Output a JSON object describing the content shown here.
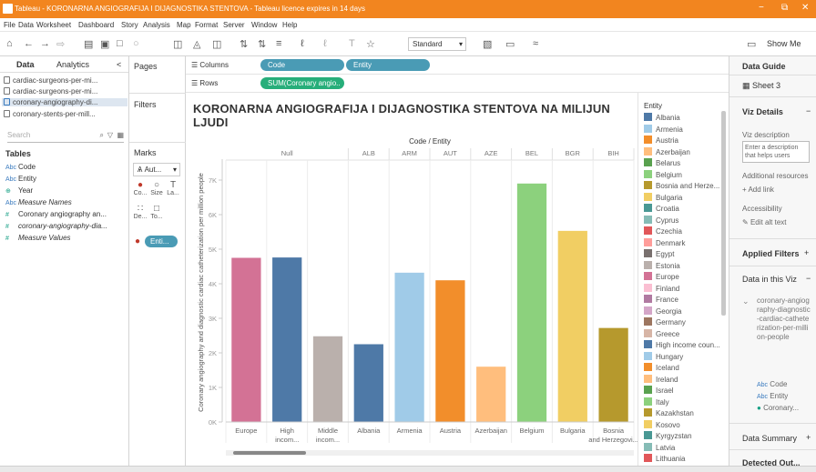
{
  "window": {
    "title": "Tableau - KORONARNA ANGIOGRAFIJA I DIJAGNOSTIKA STENTOVA - Tableau licence expires in 14 days",
    "minimize": "−",
    "restore": "⧉",
    "close": "✕"
  },
  "menu": [
    "File",
    "Data",
    "Worksheet",
    "Dashboard",
    "Story",
    "Analysis",
    "Map",
    "Format",
    "Server",
    "Window",
    "Help"
  ],
  "toolbar": {
    "view_dropdown": "Standard",
    "show_me": "Show Me"
  },
  "left_panel": {
    "tab_data": "Data",
    "tab_analytics": "Analytics",
    "collapse": "<",
    "sources": [
      "cardiac-surgeons-per-mi...",
      "cardiac-surgeons-per-mi...",
      "coronary-angiography-di...",
      "coronary-stents-per-mill..."
    ],
    "search_placeholder": "Search",
    "tables_header": "Tables",
    "fields": [
      {
        "type": "Abc",
        "name": "Code"
      },
      {
        "type": "Abc",
        "name": "Entity"
      },
      {
        "type": "⊕",
        "name": "Year"
      },
      {
        "type": "Abc",
        "name": "Measure Names"
      },
      {
        "type": "#",
        "name": "Coronary angiography an..."
      },
      {
        "type": "#",
        "name": "coronary-angiography-dia..."
      },
      {
        "type": "#",
        "name": "Measure Values"
      }
    ]
  },
  "mid_panel": {
    "pages": "Pages",
    "filters": "Filters",
    "marks": "Marks",
    "mark_type": "Aut...",
    "color": "Co...",
    "size": "Size",
    "label": "La...",
    "detail": "De...",
    "tooltip": "To...",
    "color_pill": "Enti..."
  },
  "shelves": {
    "columns_label": "Columns",
    "rows_label": "Rows",
    "col_pill_1": "Code",
    "col_pill_2": "Entity",
    "row_pill": "SUM(Coronary angio.."
  },
  "viz": {
    "title_line1": "KORONARNA ANGIOGRAFIJA I DIJAGNOSTIKA STENTOVA NA MILIJUN",
    "title_line2": "LJUDI"
  },
  "chart_data": {
    "type": "bar",
    "header": "Code / Entity",
    "code_headers": [
      "Null",
      "ALB",
      "ARM",
      "AUT",
      "AZE",
      "BEL",
      "BGR",
      "BIH"
    ],
    "categories": [
      "Europe",
      "High incom...",
      "Middle incom...",
      "Albania",
      "Armenia",
      "Austria",
      "Azerbaijan",
      "Belgium",
      "Bulgaria",
      "Bosnia and Herzegovi..."
    ],
    "values": [
      4750,
      4760,
      2480,
      2250,
      4320,
      4100,
      1600,
      6900,
      5530,
      2720
    ],
    "colors": [
      "#d37295",
      "#4e79a7",
      "#bab0ac",
      "#4e79a7",
      "#a0cbe8",
      "#f28e2b",
      "#ffbe7d",
      "#8cd17d",
      "#f1ce63",
      "#b6992d"
    ],
    "ylabel": "Coronary angiography and diagnostic cardiac catheterization per million people",
    "yticks": [
      "0K",
      "1K",
      "2K",
      "3K",
      "4K",
      "5K",
      "6K",
      "7K"
    ],
    "ylim": [
      0,
      7500
    ],
    "grid": false
  },
  "legend": {
    "header": "Entity",
    "items": [
      {
        "name": "Albania",
        "color": "#4e79a7"
      },
      {
        "name": "Armenia",
        "color": "#a0cbe8"
      },
      {
        "name": "Austria",
        "color": "#f28e2b"
      },
      {
        "name": "Azerbaijan",
        "color": "#ffbe7d"
      },
      {
        "name": "Belarus",
        "color": "#59a14f"
      },
      {
        "name": "Belgium",
        "color": "#8cd17d"
      },
      {
        "name": "Bosnia and Herze...",
        "color": "#b6992d"
      },
      {
        "name": "Bulgaria",
        "color": "#f1ce63"
      },
      {
        "name": "Croatia",
        "color": "#499894"
      },
      {
        "name": "Cyprus",
        "color": "#86bcb6"
      },
      {
        "name": "Czechia",
        "color": "#e15759"
      },
      {
        "name": "Denmark",
        "color": "#ff9d9a"
      },
      {
        "name": "Egypt",
        "color": "#79706e"
      },
      {
        "name": "Estonia",
        "color": "#bab0ac"
      },
      {
        "name": "Europe",
        "color": "#d37295"
      },
      {
        "name": "Finland",
        "color": "#fabfd2"
      },
      {
        "name": "France",
        "color": "#b07aa1"
      },
      {
        "name": "Georgia",
        "color": "#d4a6c8"
      },
      {
        "name": "Germany",
        "color": "#9d7660"
      },
      {
        "name": "Greece",
        "color": "#d7b5a6"
      },
      {
        "name": "High income coun...",
        "color": "#4e79a7"
      },
      {
        "name": "Hungary",
        "color": "#a0cbe8"
      },
      {
        "name": "Iceland",
        "color": "#f28e2b"
      },
      {
        "name": "Ireland",
        "color": "#ffbe7d"
      },
      {
        "name": "Israel",
        "color": "#59a14f"
      },
      {
        "name": "Italy",
        "color": "#8cd17d"
      },
      {
        "name": "Kazakhstan",
        "color": "#b6992d"
      },
      {
        "name": "Kosovo",
        "color": "#f1ce63"
      },
      {
        "name": "Kyrgyzstan",
        "color": "#499894"
      },
      {
        "name": "Latvia",
        "color": "#86bcb6"
      },
      {
        "name": "Lithuania",
        "color": "#e15759"
      }
    ]
  },
  "right_panel": {
    "data_guide": "Data Guide",
    "sheet": "Sheet 3",
    "viz_details": "Viz Details",
    "viz_description": "Viz description",
    "description_placeholder": "Enter a description that helps users",
    "additional_resources": "Additional resources",
    "add_link": "Add link",
    "accessibility": "Accessibility",
    "edit_alt_text": "Edit alt text",
    "applied_filters": "Applied Filters",
    "data_in_viz": "Data in this Viz",
    "source_name": "coronary-angiography-diagnostic-cardiac-catheterization-per-million-people",
    "field_code": "Code",
    "field_entity": "Entity",
    "field_measure": "Coronary...",
    "data_summary": "Data Summary",
    "detected_out": "Detected Out..."
  }
}
